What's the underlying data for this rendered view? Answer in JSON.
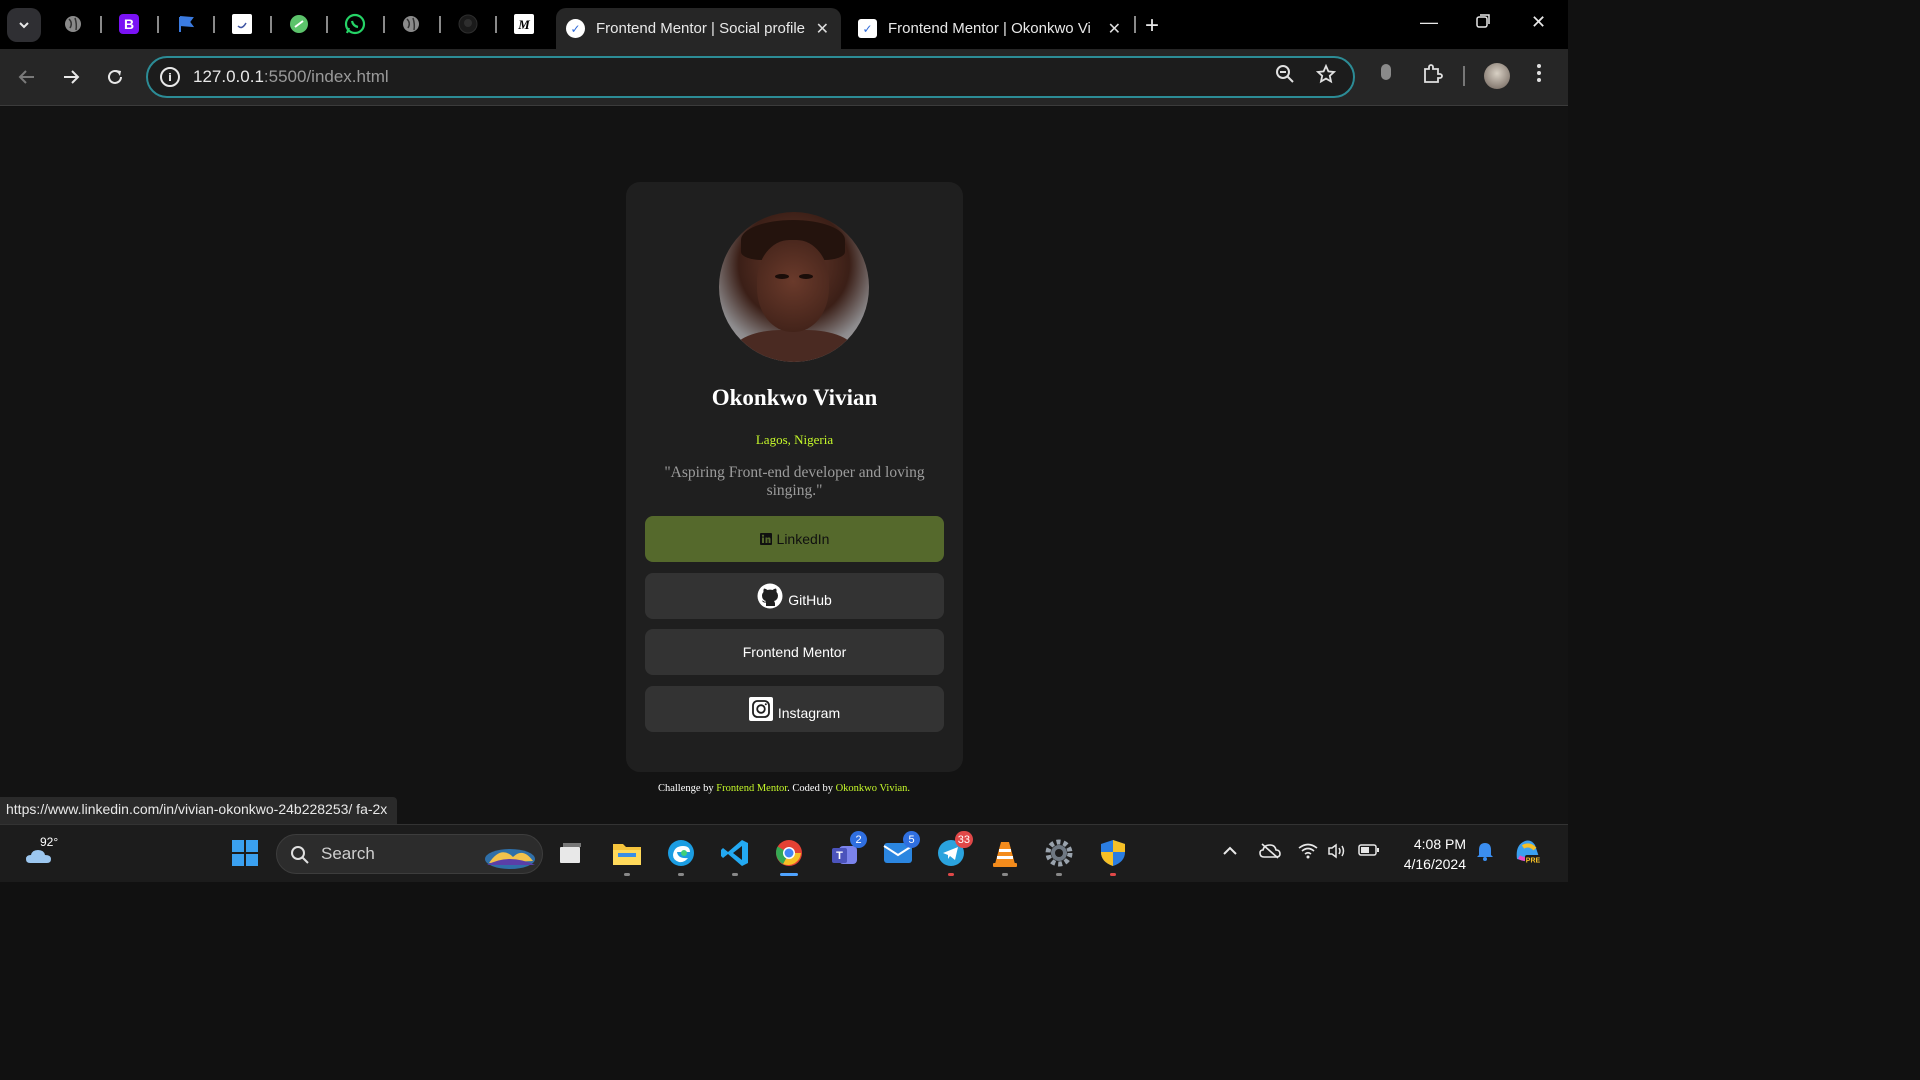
{
  "browser": {
    "tabs": [
      {
        "title": "Frontend Mentor | Social profile",
        "active": true
      },
      {
        "title": "Frontend Mentor | Okonkwo Vi",
        "active": false
      }
    ],
    "pinned_icons": [
      "globe-icon",
      "bootstrap-icon",
      "flag-icon",
      "frontend-mentor-icon",
      "green-app-icon",
      "whatsapp-icon",
      "globe-icon",
      "github-icon",
      "medium-icon"
    ],
    "address": {
      "host": "127.0.0.1",
      "rest": ":5500/index.html"
    }
  },
  "profile": {
    "name": "Okonkwo Vivian",
    "location": "Lagos, Nigeria",
    "bio": "\"Aspiring Front-end developer and loving singing.\"",
    "links": [
      {
        "label": "LinkedIn",
        "icon": "linkedin-icon"
      },
      {
        "label": "GitHub",
        "icon": "github-icon"
      },
      {
        "label": "Frontend Mentor",
        "icon": ""
      },
      {
        "label": "Instagram",
        "icon": "instagram-icon"
      }
    ],
    "accent": "#c5f82a",
    "button_color": "#333333",
    "hover_color": "#55692c"
  },
  "footer": {
    "prefix": "Challenge by ",
    "challenge_link": "Frontend Mentor",
    "middle": ". Coded by ",
    "author_link": "Okonkwo Vivian",
    "suffix": "."
  },
  "status_url": "https://www.linkedin.com/in/vivian-okonkwo-24b228253/ fa-2x",
  "taskbar": {
    "weather_temp": "92°",
    "search_label": "Search",
    "badges": {
      "teams": "2",
      "mail": "5",
      "telegram": "33"
    },
    "time": "4:08 PM",
    "date": "4/16/2024"
  }
}
